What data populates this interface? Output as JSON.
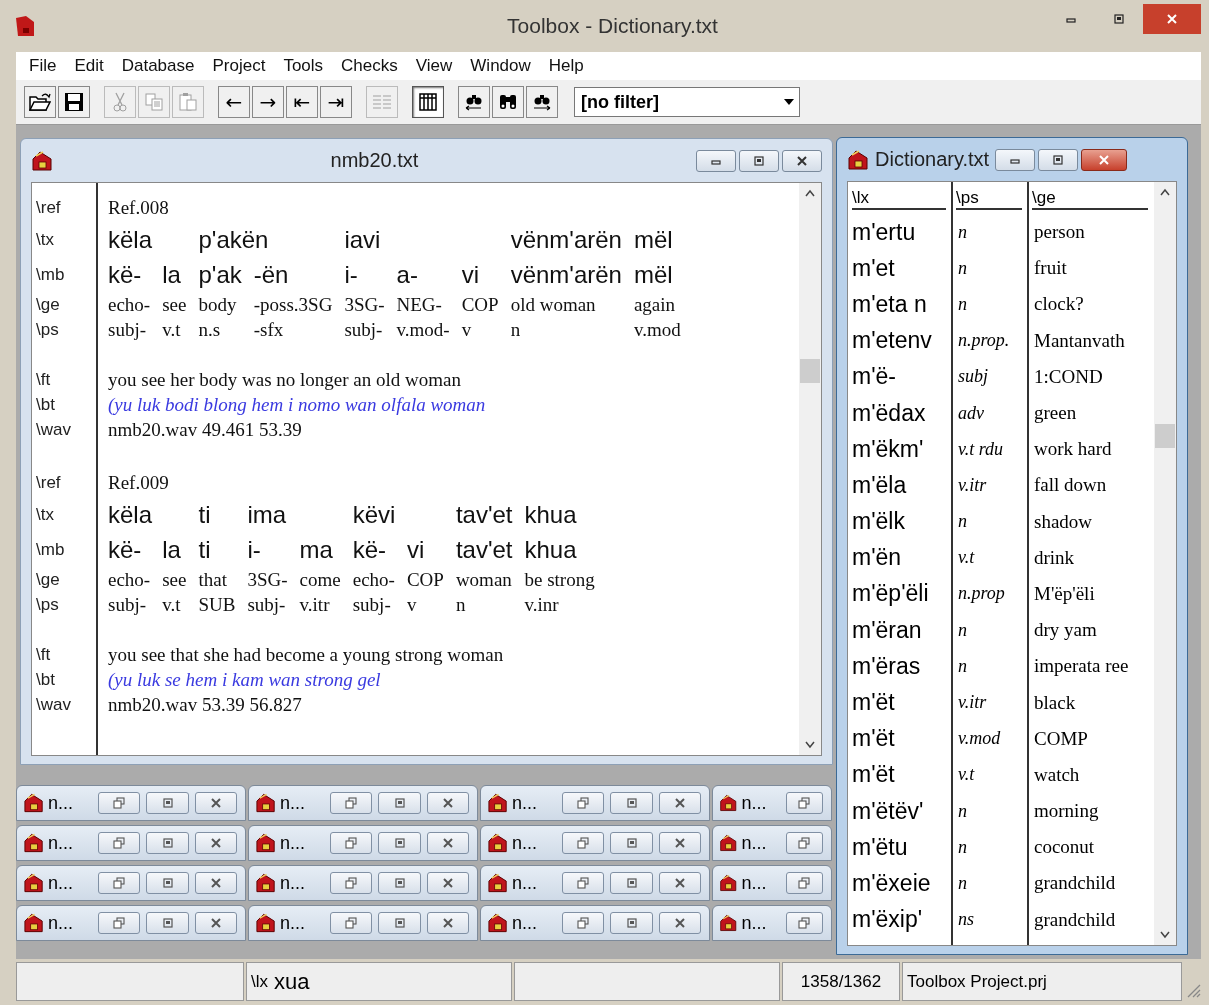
{
  "window": {
    "title": "Toolbox - Dictionary.txt"
  },
  "menu": [
    "File",
    "Edit",
    "Database",
    "Project",
    "Tools",
    "Checks",
    "View",
    "Window",
    "Help"
  ],
  "toolbar": [
    {
      "kind": "open",
      "disabled": false,
      "pressed": false
    },
    {
      "kind": "save",
      "disabled": false,
      "pressed": false
    },
    {
      "kind": "sep"
    },
    {
      "kind": "cut",
      "disabled": true,
      "pressed": false
    },
    {
      "kind": "copy",
      "disabled": true,
      "pressed": false
    },
    {
      "kind": "paste",
      "disabled": true,
      "pressed": false
    },
    {
      "kind": "sep"
    },
    {
      "kind": "glyph",
      "text": "←",
      "disabled": false,
      "pressed": false
    },
    {
      "kind": "glyph",
      "text": "→",
      "disabled": false,
      "pressed": false
    },
    {
      "kind": "glyph",
      "text": "⇤",
      "disabled": false,
      "pressed": false
    },
    {
      "kind": "glyph",
      "text": "⇥",
      "disabled": false,
      "pressed": false
    },
    {
      "kind": "sep"
    },
    {
      "kind": "list",
      "disabled": true,
      "pressed": false
    },
    {
      "kind": "sep"
    },
    {
      "kind": "browse",
      "disabled": false,
      "pressed": true
    },
    {
      "kind": "sep"
    },
    {
      "kind": "find-prev",
      "disabled": false,
      "pressed": false
    },
    {
      "kind": "find",
      "disabled": false,
      "pressed": false
    },
    {
      "kind": "find-next",
      "disabled": false,
      "pressed": false
    }
  ],
  "filter": {
    "value": "[no filter]"
  },
  "text_window": {
    "title": "nmb20.txt",
    "active": false,
    "records": [
      {
        "ref": {
          "marker": "\\ref",
          "text": "Ref.008"
        },
        "interlinear_markers": [
          "\\tx",
          "\\mb",
          "\\ge",
          "\\ps"
        ],
        "words": [
          {
            "tx": "këla",
            "morphemes": [
              {
                "mb": "kë-",
                "ge": "echo-",
                "ps": "subj-"
              },
              {
                "mb": "la",
                "ge": "see",
                "ps": "v.t"
              }
            ]
          },
          {
            "tx": "p'akën",
            "morphemes": [
              {
                "mb": "p'ak",
                "ge": "body",
                "ps": "n.s"
              },
              {
                "mb": "-ën",
                "ge": "-poss.3SG",
                "ps": "-sfx"
              }
            ]
          },
          {
            "tx": "iavi",
            "morphemes": [
              {
                "mb": "i-",
                "ge": "3SG-",
                "ps": "subj-"
              },
              {
                "mb": "a-",
                "ge": "NEG-",
                "ps": "v.mod-"
              },
              {
                "mb": "vi",
                "ge": "COP",
                "ps": "v"
              }
            ]
          },
          {
            "tx": "vënm'arën",
            "morphemes": [
              {
                "mb": "vënm'arën",
                "ge": "old woman",
                "ps": "n"
              }
            ]
          },
          {
            "tx": "mël",
            "morphemes": [
              {
                "mb": "mël",
                "ge": "again",
                "ps": "v.mod"
              }
            ]
          }
        ],
        "lines": [
          {
            "kind": "ft",
            "marker": "\\ft",
            "text": "you see her body was no longer an old woman"
          },
          {
            "kind": "bt",
            "marker": "\\bt",
            "text": "(yu luk bodi blong hem i nomo wan olfala woman"
          },
          {
            "kind": "wav",
            "marker": "\\wav",
            "text": "nmb20.wav 49.461 53.39"
          }
        ]
      },
      {
        "ref": {
          "marker": "\\ref",
          "text": "Ref.009"
        },
        "interlinear_markers": [
          "\\tx",
          "\\mb",
          "\\ge",
          "\\ps"
        ],
        "words": [
          {
            "tx": "këla",
            "morphemes": [
              {
                "mb": "kë-",
                "ge": "echo-",
                "ps": "subj-"
              },
              {
                "mb": "la",
                "ge": "see",
                "ps": "v.t"
              }
            ]
          },
          {
            "tx": "ti",
            "morphemes": [
              {
                "mb": "ti",
                "ge": "that",
                "ps": "SUB"
              }
            ]
          },
          {
            "tx": "ima",
            "morphemes": [
              {
                "mb": "i-",
                "ge": "3SG-",
                "ps": "subj-"
              },
              {
                "mb": "ma",
                "ge": "come",
                "ps": "v.itr"
              }
            ]
          },
          {
            "tx": "këvi",
            "morphemes": [
              {
                "mb": "kë-",
                "ge": "echo-",
                "ps": "subj-"
              },
              {
                "mb": "vi",
                "ge": "COP",
                "ps": "v"
              }
            ]
          },
          {
            "tx": "tav'et",
            "morphemes": [
              {
                "mb": "tav'et",
                "ge": "woman",
                "ps": "n"
              }
            ]
          },
          {
            "tx": "khua",
            "morphemes": [
              {
                "mb": "khua",
                "ge": "be strong",
                "ps": "v.inr"
              }
            ]
          }
        ],
        "lines": [
          {
            "kind": "ft",
            "marker": "\\ft",
            "text": "you see that she had become a young strong woman"
          },
          {
            "kind": "bt",
            "marker": "\\bt",
            "text": "(yu luk se hem i kam wan strong gel"
          },
          {
            "kind": "wav",
            "marker": "\\wav",
            "text": "nmb20.wav 53.39 56.827"
          }
        ]
      }
    ]
  },
  "dictionary_window": {
    "title": "Dictionary.txt",
    "active": true,
    "columns": [
      "\\lx",
      "\\ps",
      "\\ge"
    ],
    "entries": [
      {
        "lx": "m'ertu",
        "ps": "n",
        "ge": "person"
      },
      {
        "lx": "m'et",
        "ps": "n",
        "ge": "fruit"
      },
      {
        "lx": "m'eta n",
        "ps": "n",
        "ge": "clock?"
      },
      {
        "lx": "m'etenv",
        "ps": "n.prop.",
        "ge": "Mantanvath"
      },
      {
        "lx": "m'ë-",
        "ps": "subj",
        "ge": "1:COND"
      },
      {
        "lx": "m'ëdax",
        "ps": "adv",
        "ge": "green"
      },
      {
        "lx": "m'ëkm'",
        "ps": "v.t rdu",
        "ge": "work hard"
      },
      {
        "lx": "m'ëla",
        "ps": "v.itr",
        "ge": "fall down"
      },
      {
        "lx": "m'ëlk",
        "ps": "n",
        "ge": "shadow"
      },
      {
        "lx": "m'ën",
        "ps": "v.t",
        "ge": "drink"
      },
      {
        "lx": "m'ëp'ëli",
        "ps": "n.prop",
        "ge": "M'ëp'ëli"
      },
      {
        "lx": "m'ëran",
        "ps": "n",
        "ge": "dry yam"
      },
      {
        "lx": "m'ëras",
        "ps": "n",
        "ge": "imperata ree"
      },
      {
        "lx": "m'ët",
        "ps": "v.itr",
        "ge": "black"
      },
      {
        "lx": "m'ët",
        "ps": "v.mod",
        "ge": "COMP"
      },
      {
        "lx": "m'ët",
        "ps": "v.t",
        "ge": "watch"
      },
      {
        "lx": "m'ëtëv'",
        "ps": "n",
        "ge": "morning"
      },
      {
        "lx": "m'ëtu",
        "ps": "n",
        "ge": "coconut"
      },
      {
        "lx": "m'ëxeie",
        "ps": "n",
        "ge": "grandchild"
      },
      {
        "lx": "m'ëxip'",
        "ps": "ns",
        "ge": "grandchild"
      }
    ]
  },
  "minimized_windows": [
    {
      "label": "n...",
      "kind": "full"
    },
    {
      "label": "n...",
      "kind": "full"
    },
    {
      "label": "n...",
      "kind": "full"
    },
    {
      "label": "n...",
      "kind": "partial"
    },
    {
      "label": "n...",
      "kind": "full"
    },
    {
      "label": "n...",
      "kind": "full"
    },
    {
      "label": "n...",
      "kind": "full"
    },
    {
      "label": "n...",
      "kind": "partial"
    },
    {
      "label": "n...",
      "kind": "full"
    },
    {
      "label": "n...",
      "kind": "full"
    },
    {
      "label": "n...",
      "kind": "full"
    },
    {
      "label": "n...",
      "kind": "partial"
    },
    {
      "label": "n...",
      "kind": "full"
    },
    {
      "label": "n...",
      "kind": "full"
    },
    {
      "label": "n...",
      "kind": "full"
    },
    {
      "label": "n...",
      "kind": "partial"
    }
  ],
  "status_bar": {
    "field_marker": "\\lx",
    "field_value": "xua",
    "record_count": "1358/1362",
    "project": "Toolbox Project.prj"
  }
}
